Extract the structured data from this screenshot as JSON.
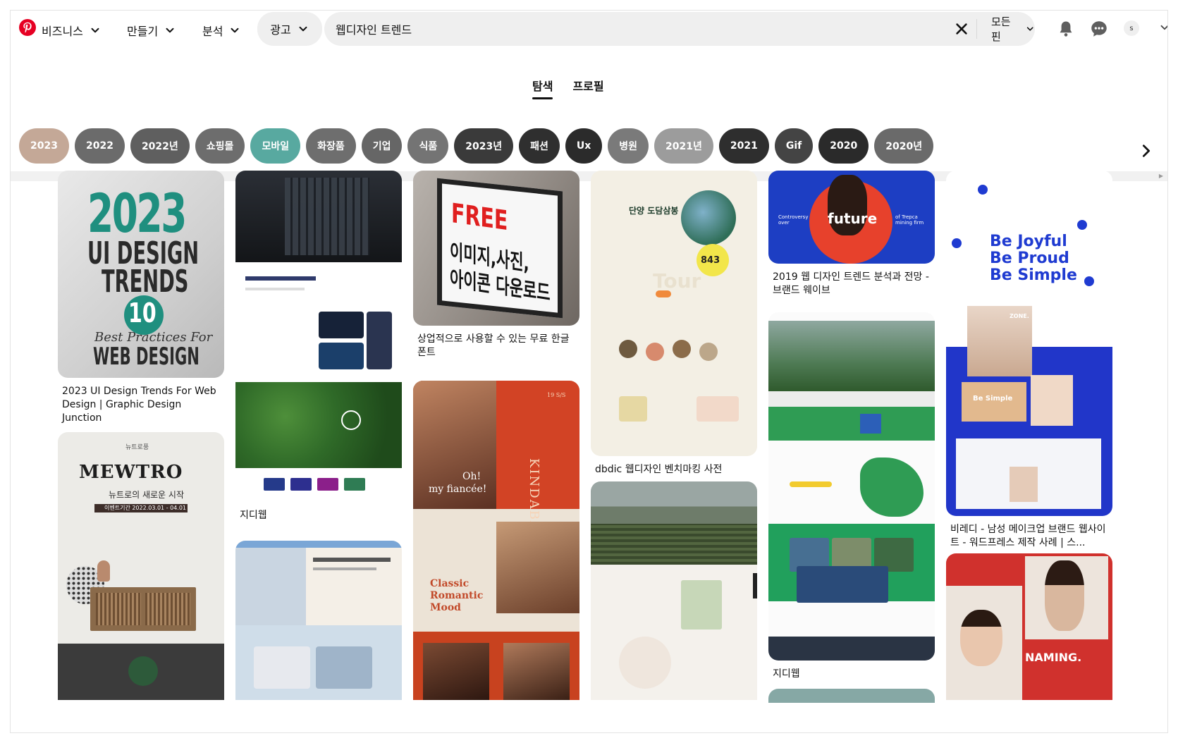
{
  "header": {
    "business_label": "비즈니스",
    "create_label": "만들기",
    "analytics_label": "분석",
    "ads_label": "광고",
    "search_value": "웹디자인 트렌드",
    "filter_label": "모든 핀",
    "avatar_initial": "s"
  },
  "tabs": [
    {
      "label": "탐색",
      "active": true
    },
    {
      "label": "프로필",
      "active": false
    }
  ],
  "chips": [
    {
      "label": "2023",
      "color": "#c4a897"
    },
    {
      "label": "2022",
      "color": "#6b6b6b"
    },
    {
      "label": "2022년",
      "color": "#5f5f5f"
    },
    {
      "label": "쇼핑몰",
      "color": "#6d6d6d"
    },
    {
      "label": "모바일",
      "color": "#58a9a0"
    },
    {
      "label": "화장품",
      "color": "#6e6e6e"
    },
    {
      "label": "기업",
      "color": "#666666"
    },
    {
      "label": "식품",
      "color": "#747474"
    },
    {
      "label": "2023년",
      "color": "#3a3a3a"
    },
    {
      "label": "패션",
      "color": "#2f2f2f"
    },
    {
      "label": "Ux",
      "color": "#2b2b2b"
    },
    {
      "label": "병원",
      "color": "#7a7a7a"
    },
    {
      "label": "2021년",
      "color": "#9c9c9c"
    },
    {
      "label": "2021",
      "color": "#2e2e2e"
    },
    {
      "label": "Gif",
      "color": "#444444"
    },
    {
      "label": "2020",
      "color": "#2a2a2a"
    },
    {
      "label": "2020년",
      "color": "#6a6a6a"
    }
  ],
  "pins": {
    "p1": {
      "title": "2023 UI Design Trends For Web Design | Graphic Design Junction",
      "img": {
        "year": "2023",
        "line1": "UI DESIGN",
        "line2": "TRENDS",
        "num": "10",
        "script": "Best Practices For",
        "bottom": "WEB DESIGN"
      }
    },
    "p2": {
      "img": {
        "small": "뉴트로풍",
        "mewtro": "MEWTRO",
        "sub": "뉴트로의 새로운 시작",
        "band": "이벤트기간 2022.03.01 - 04.01"
      }
    },
    "p3": {
      "title": "지디웹"
    },
    "p5": {
      "title": "상업적으로 사용할 수 있는 무료 한글 폰트",
      "img": {
        "free": "FREE",
        "l1": "이미지,사진,",
        "l2": "아이콘 다운로드"
      }
    },
    "p6": {
      "img": {
        "side": "KINDABABY",
        "oh": "Oh!",
        "fiancee": "my fiancée!",
        "classic": "Classic",
        "romantic": "Romantic",
        "mood": "Mood",
        "ss": "19 S/S"
      }
    },
    "p7": {
      "title": "dbdic 웹디자인 벤치마킹 사전",
      "img": {
        "heading": "단양 도담삼봉",
        "count": "843",
        "tour": "Tour"
      }
    },
    "p9": {
      "title": "2019 웹 디자인 트렌드 분석과 전망 - 브랜드 웨이브",
      "img": {
        "word": "future",
        "left": "Controversy over",
        "right": "of Trepca mining firm"
      }
    },
    "p10": {
      "title": "지디웹"
    },
    "p11": {
      "title": "비레디 - 남성 메이크업 브랜드 웹사이트 - 워드프레스 제작 사례 | 스...",
      "img": {
        "l1": "Be Joyful",
        "l2": "Be Proud",
        "l3": "Be Simple",
        "small": "Be Simple",
        "tag": "ZONE."
      }
    },
    "p12": {
      "img": {
        "brand": "NAMING."
      }
    }
  }
}
